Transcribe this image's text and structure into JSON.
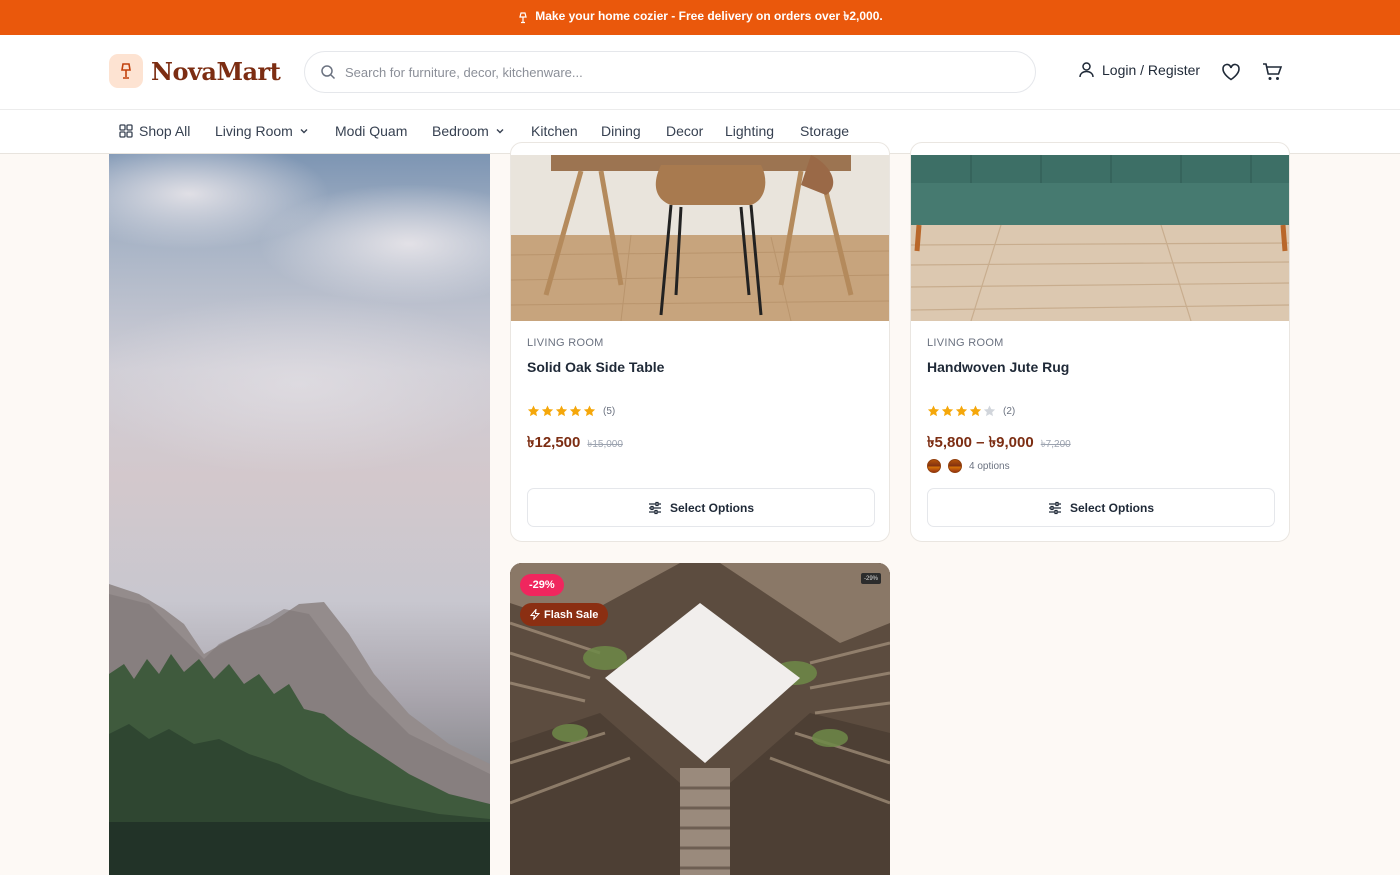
{
  "announcement": {
    "text": "Make your home cozier - Free delivery on orders over ৳2,000."
  },
  "header": {
    "logo_text": "NovaMart",
    "search_placeholder": "Search for furniture, decor, kitchenware...",
    "login_label": "Login / Register",
    "icons": [
      "logo-lamp-icon",
      "search-icon",
      "user-icon",
      "heart-icon",
      "cart-icon"
    ]
  },
  "nav": {
    "items": [
      {
        "label": "Shop All",
        "icon": "grid-icon"
      },
      {
        "label": "Living Room",
        "dropdown": true
      },
      {
        "label": "Modi Quam"
      },
      {
        "label": "Bedroom",
        "dropdown": true
      },
      {
        "label": "Kitchen"
      },
      {
        "label": "Dining"
      },
      {
        "label": "Decor"
      },
      {
        "label": "Lighting"
      },
      {
        "label": "Storage"
      }
    ]
  },
  "products": [
    {
      "category": "LIVING ROOM",
      "name": "Solid Oak Side Table",
      "rating": 5,
      "review_count": "(5)",
      "price": "৳12,500",
      "old_price": "৳15,000",
      "button": "Select Options"
    },
    {
      "category": "LIVING ROOM",
      "name": "Handwoven Jute Rug",
      "rating": 4,
      "review_count": "(2)",
      "price": "৳5,800 – ৳9,000",
      "old_price": "৳7,200",
      "options_label": "4 options",
      "button": "Select Options"
    },
    {
      "badge_discount": "-29%",
      "badge_flash": "Flash Sale",
      "badge_small": "-29%"
    }
  ],
  "colors": {
    "accent": "#ea580c",
    "brand": "#7c2d12",
    "star": "#f5a70a",
    "discount_badge": "#f0265e"
  }
}
